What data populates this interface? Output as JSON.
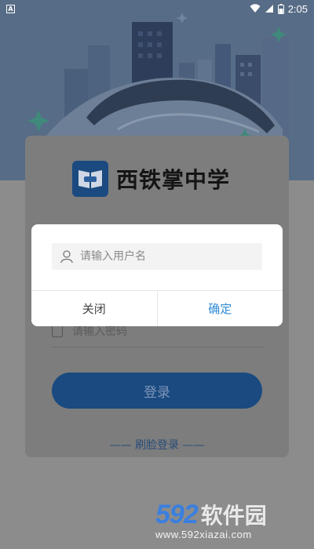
{
  "status_bar": {
    "time": "2:05",
    "app_badge": "A"
  },
  "brand": {
    "name": "西铁掌中学"
  },
  "login": {
    "password_placeholder": "请输入密码",
    "login_button": "登录",
    "face_login": "—— 刷脸登录 ——"
  },
  "dialog": {
    "username_placeholder": "请输入用户名",
    "cancel_label": "关闭",
    "confirm_label": "确定"
  },
  "watermark": {
    "numbers": "592",
    "text": "软件园",
    "url": "www.592xiazai.com"
  },
  "colors": {
    "primary": "#1a4a80",
    "confirm_text": "#2f8bd6",
    "overlay": "#8c8c8c"
  }
}
